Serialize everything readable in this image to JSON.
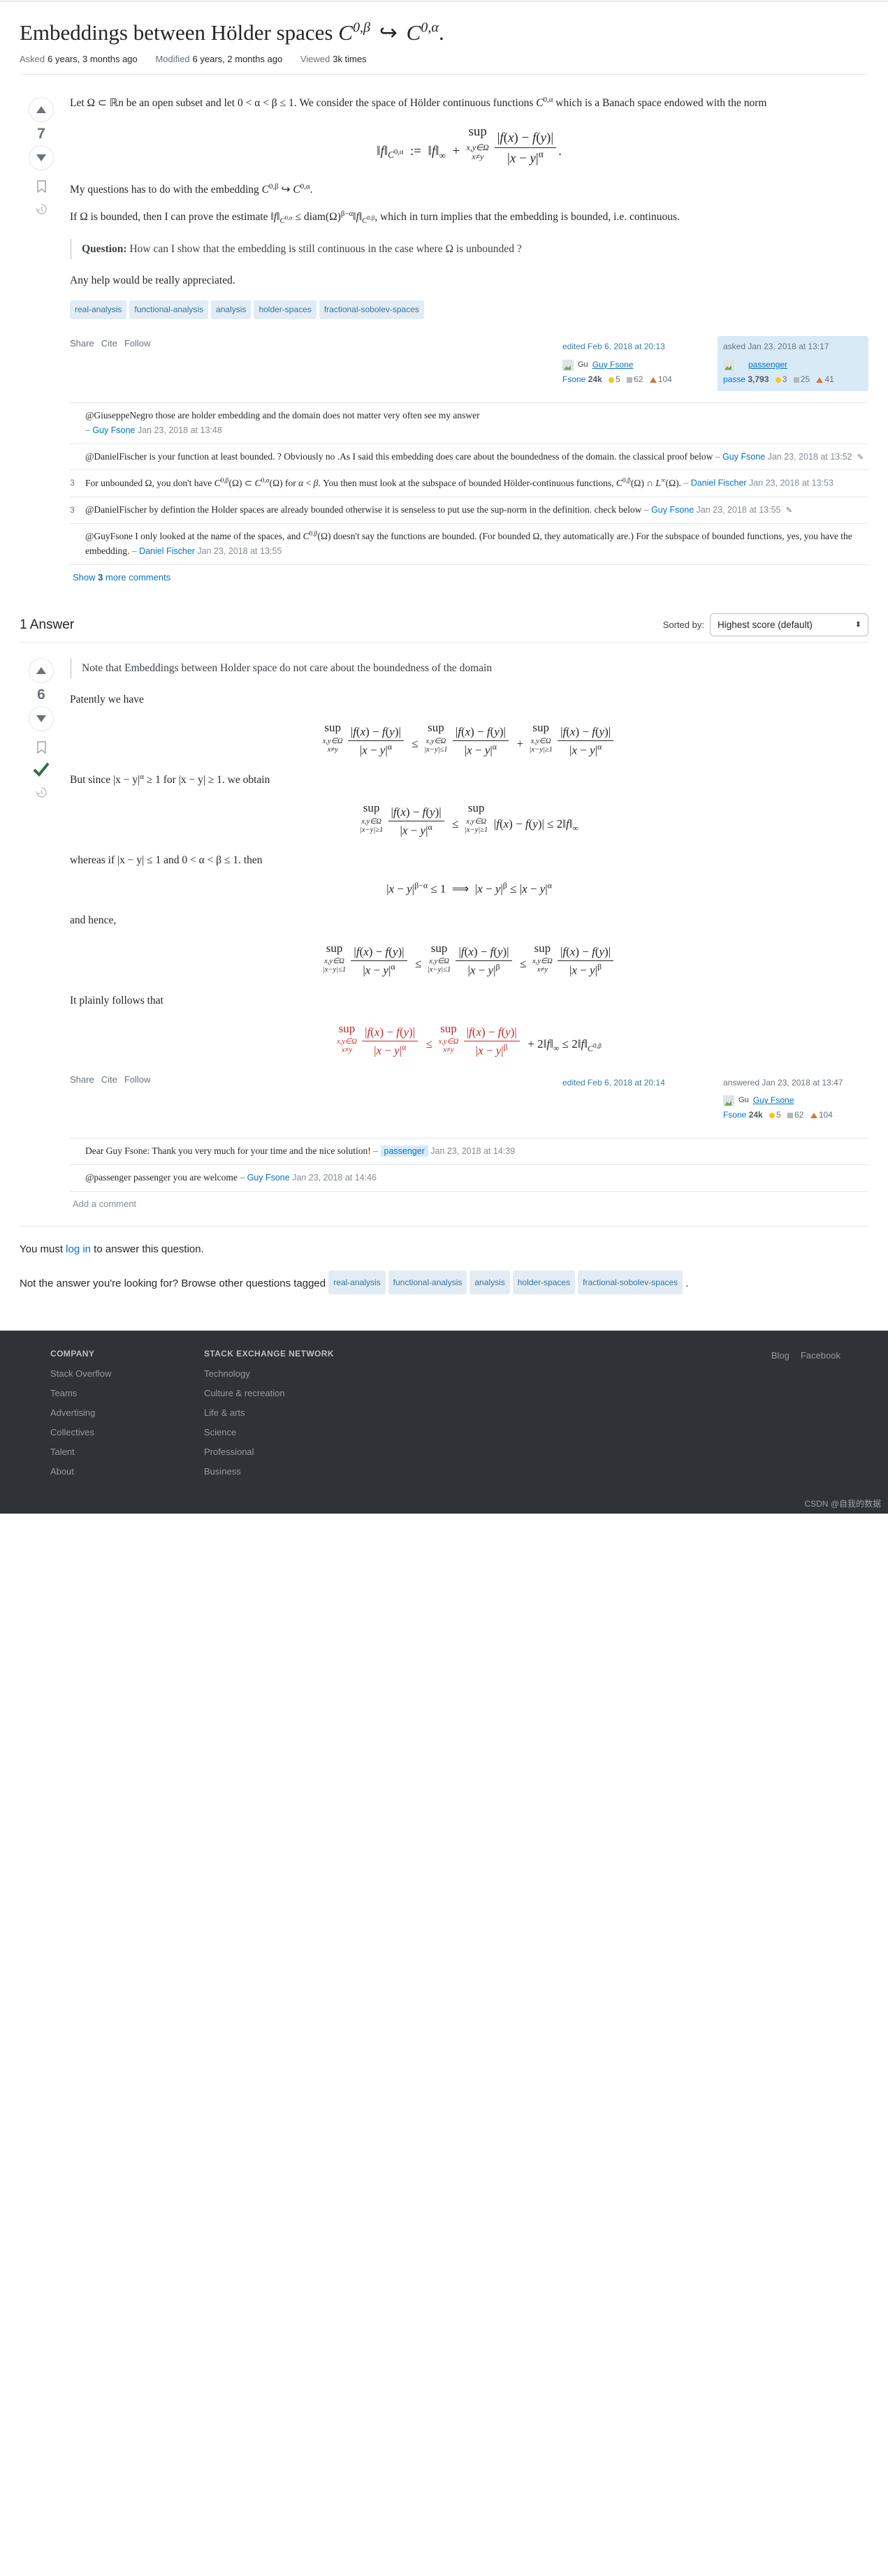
{
  "question": {
    "title_text": "Embeddings between Hölder spaces",
    "title_math_1": "C",
    "title_sup_1": "0,β",
    "title_arrow": "↪",
    "title_math_2": "C",
    "title_sup_2": "0,α",
    "title_period": ".",
    "asked_label": "Asked",
    "asked_value": "6 years, 3 months ago",
    "modified_label": "Modified",
    "modified_value": "6 years, 2 months ago",
    "viewed_label": "Viewed",
    "viewed_value": "3k times",
    "vote_score": "7",
    "para1_a": "Let Ω ⊂ ℝ",
    "para1_b": "n",
    "para1_c": " be an open subset and let 0 < α < β ≤ 1. We consider the space of Hölder continuous functions ",
    "para1_d": "C",
    "para1_e": "0,α",
    "para1_f": " which is a Banach space endowed with the norm",
    "para2_a": "My questions has to do with the embedding ",
    "para2_b": "C",
    "para2_c": "0,β",
    "para2_d": " ↪ ",
    "para2_e": "C",
    "para2_f": "0,α",
    "para2_g": ".",
    "para3_a": "If Ω is bounded, then I can prove the estimate ",
    "para3_b": "‖f‖",
    "para3_c": "C",
    "para3_d": "0,α",
    "para3_e": " ≤ diam(Ω)",
    "para3_f": "β−α",
    "para3_g": "‖f‖",
    "para3_h": "C",
    "para3_i": "0,β",
    "para3_j": ", which in turn implies that the embedding is bounded, i.e. continuous.",
    "quote_label": "Question:",
    "quote_text": " How can I show that the embedding is still continuous in the case where Ω is unbounded ?",
    "para4": "Any help would be really appreciated.",
    "tags": [
      "real-analysis",
      "functional-analysis",
      "analysis",
      "holder-spaces",
      "fractional-sobolev-spaces"
    ],
    "actions": [
      "Share",
      "Cite",
      "Follow"
    ],
    "edited_card": {
      "when": "edited Feb 6, 2018 at 20:13",
      "avatar_text": "Gu",
      "name": "Guy Fsone",
      "name_short": "Fsone",
      "rep": "24k",
      "gold": "5",
      "silver": "62",
      "bronze": "104"
    },
    "asked_card": {
      "when": "asked Jan 23, 2018 at 13:17",
      "avatar_text": "",
      "name": "passenger",
      "name_short": "passe",
      "rep": "3,793",
      "gold": "3",
      "silver": "25",
      "bronze": "41"
    },
    "comments": [
      {
        "score": "",
        "text": "@GiuseppeNegro those are holder embedding and the domain does not matter very often see my answer",
        "dash": "–",
        "user": "Guy Fsone",
        "date": "Jan 23, 2018 at 13:48",
        "edited": false
      },
      {
        "score": "",
        "text": "@DanielFischer is your function at least bounded. ? Obviously no .As I said this embedding does care about the boundedness of the domain. the classical proof below",
        "dash": "–",
        "user": "Guy Fsone",
        "date": "Jan 23, 2018 at 13:52",
        "edited": true
      },
      {
        "score": "3",
        "text": "For unbounded Ω, you don't have C0,β(Ω) ⊂ C0,α(Ω) for α < β. You then must look at the subspace of bounded Hölder-continuous functions, C0,β(Ω) ∩ L∞(Ω).",
        "dash": "–",
        "user": "Daniel Fischer",
        "date": "Jan 23, 2018 at 13:53",
        "edited": false
      },
      {
        "score": "3",
        "text": "@DanielFischer by defintion the Holder spaces are already bounded otherwise it is senseless to put use the sup-norm in the definition. check below",
        "dash": "–",
        "user": "Guy Fsone",
        "date": "Jan 23, 2018 at 13:55",
        "edited": true
      },
      {
        "score": "",
        "text": "@GuyFsone I only looked at the name of the spaces, and C0,β(Ω) doesn't say the functions are bounded. (For bounded Ω, they automatically are.) For the subspace of bounded functions, yes, you have the embedding.",
        "dash": "–",
        "user": "Daniel Fischer",
        "date": "Jan 23, 2018 at 13:55",
        "edited": false
      }
    ],
    "show_more_pre": "Show ",
    "show_more_count": "3",
    "show_more_post": " more comments"
  },
  "answers_section": {
    "heading": "1 Answer",
    "sorted_label": "Sorted by:",
    "sorted_value": "Highest score (default)"
  },
  "answer": {
    "vote_score": "6",
    "quote": "Note that Embeddings between Holder space do not care about the boundedness of the domain",
    "p1": "Patently we have",
    "p2_a": "But since |x − y|",
    "p2_b": "α",
    "p2_c": " ≥ 1 for |x − y| ≥ 1. we obtain",
    "p3": "whereas if |x − y| ≤ 1 and 0 < α < β ≤ 1. then",
    "p4": "and hence,",
    "p5": "It plainly follows that",
    "actions": [
      "Share",
      "Cite",
      "Follow"
    ],
    "edited_card": {
      "when": "edited Feb 6, 2018 at 20:14"
    },
    "answered_card": {
      "when": "answered Jan 23, 2018 at 13:47",
      "avatar_text": "Gu",
      "name": "Guy Fsone",
      "name_short": "Fsone",
      "rep": "24k",
      "gold": "5",
      "silver": "62",
      "bronze": "104"
    },
    "comments": [
      {
        "text": "Dear Guy Fsone: Thank you very much for your time and the nice solution!",
        "dash": "–",
        "user": "passenger",
        "user_highlight": true,
        "date": "Jan 23, 2018 at 14:39"
      },
      {
        "text": "@passenger passenger you are welcome",
        "dash": "–",
        "user": "Guy Fsone",
        "user_highlight": false,
        "date": "Jan 23, 2018 at 14:46"
      }
    ],
    "add_comment": "Add a comment"
  },
  "bottom": {
    "login_pre": "You must ",
    "login_link": "log in",
    "login_post": " to answer this question.",
    "browse_pre": "Not the answer you're looking for? Browse other questions tagged",
    "browse_tags": [
      "real-analysis",
      "functional-analysis",
      "analysis",
      "holder-spaces",
      "fractional-sobolev-spaces"
    ],
    "browse_post": "."
  },
  "footer": {
    "company_head": "COMPANY",
    "company_links": [
      "Stack Overflow",
      "Teams",
      "Advertising",
      "Collectives",
      "Talent",
      "About"
    ],
    "network_head": "STACK EXCHANGE NETWORK",
    "network_links": [
      "Technology",
      "Culture & recreation",
      "Life & arts",
      "Science",
      "Professional",
      "Business"
    ],
    "right_links": [
      "Blog",
      "Facebook"
    ],
    "watermark": "CSDN @自我的数据"
  }
}
